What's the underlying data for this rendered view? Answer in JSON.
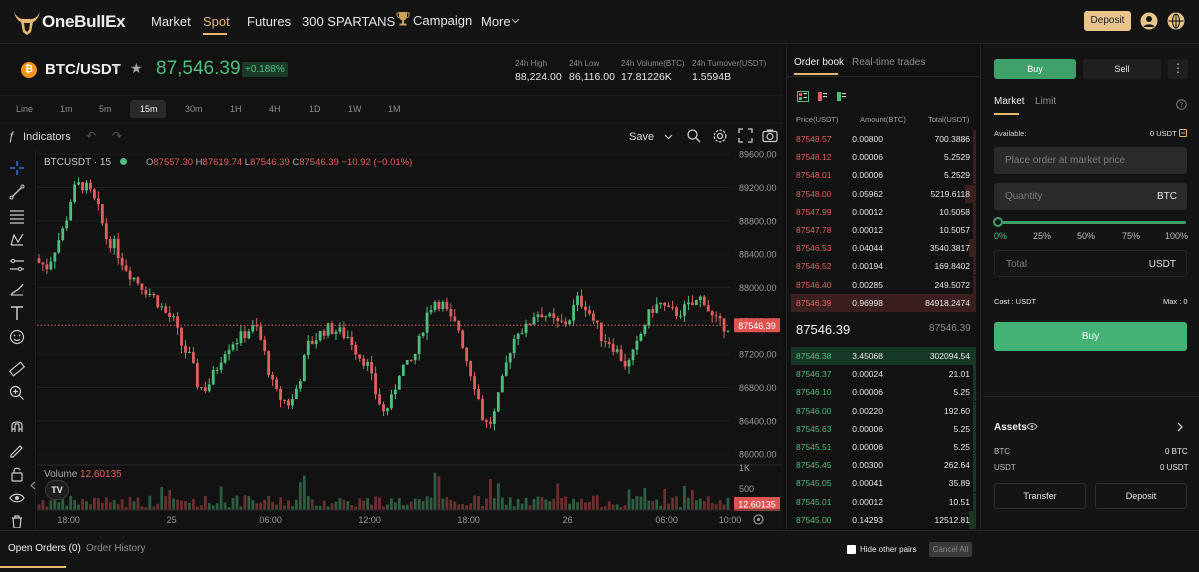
{
  "nav": {
    "logo": "OneBullEx",
    "items": [
      "Market",
      "Spot",
      "Futures",
      "300 SPARTANS",
      "Campaign",
      "More"
    ],
    "deposit": "Deposit"
  },
  "ticker": {
    "pair": "BTC/USDT",
    "price": "87,546.39",
    "change": "+0.188%",
    "stats": [
      {
        "label": "24h High",
        "value": "88,224.00"
      },
      {
        "label": "24h Low",
        "value": "86,116.00"
      },
      {
        "label": "24h Volume(BTC)",
        "value": "17.81226K"
      },
      {
        "label": "24h Turnover(USDT)",
        "value": "1.5594B"
      }
    ]
  },
  "intervals": [
    "Line",
    "1m",
    "5m",
    "15m",
    "30m",
    "1H",
    "4H",
    "1D",
    "1W",
    "1M"
  ],
  "toolbar": {
    "indicators": "Indicators",
    "save": "Save"
  },
  "chart": {
    "symbol": "BTCUSDT · 15",
    "ohlc": {
      "o_label": "O",
      "o": "87557.30",
      "h_label": "H",
      "h": "87619.74",
      "l_label": "L",
      "l": "87546.39",
      "c_label": "C",
      "c": "87546.39",
      "chg": "−10.92 (−0.01%)"
    },
    "volume_label": "Volume",
    "volume_value": "12.60135",
    "tv": "TV"
  },
  "chart_data": {
    "type": "candlestick",
    "y_ticks": [
      89600,
      89200,
      88800,
      88400,
      88000,
      87600,
      87200,
      86800,
      86400,
      86000
    ],
    "y_tick_labels": [
      "89600.00",
      "89200.00",
      "88800.00",
      "88400.00",
      "88000.00",
      "87600.00",
      "87200.00",
      "86800.00",
      "86400.00",
      "86000.00"
    ],
    "ylim": [
      85930,
      89650
    ],
    "x_tick_labels": [
      "18:00",
      "25",
      "06:00",
      "12:00",
      "18:00",
      "26",
      "06:00",
      "10:00"
    ],
    "x_tick_index": [
      8,
      34,
      59,
      84,
      109,
      134,
      159,
      175
    ],
    "current_price": 87546.39,
    "current_price_label": "87546.39",
    "vol_ticks": [
      "1K",
      "500"
    ],
    "volume_label_right": "12.60135",
    "close_path": [
      88300,
      88250,
      88500,
      88720,
      89150,
      89250,
      89150,
      88950,
      88600,
      88500,
      88300,
      88150,
      88050,
      87950,
      87850,
      87700,
      87600,
      87300,
      87150,
      86800,
      86800,
      87000,
      87250,
      87350,
      87400,
      87500,
      87500,
      87150,
      86750,
      86650,
      86600,
      86900,
      87300,
      87400,
      87500,
      87500,
      87450,
      87400,
      87200,
      87100,
      86750,
      86500,
      86650,
      87050,
      87050,
      87250,
      87650,
      87850,
      87800,
      87600,
      87500,
      87100,
      86800,
      86350,
      86400,
      86800,
      87250,
      87500,
      87500,
      87700,
      87700,
      87600,
      87550,
      87600,
      87850,
      87800,
      87600,
      87400,
      87350,
      87200,
      87050,
      87250,
      87550,
      87750,
      87800,
      87700,
      87700,
      87750,
      87800,
      87900,
      87650,
      87550,
      87546
    ]
  },
  "orderbook": {
    "tabs": [
      "Order book",
      "Real-time trades"
    ],
    "headers": [
      "Price(USDT)",
      "Amount(BTC)",
      "Total(USDT)"
    ],
    "asks": [
      [
        "87548.57",
        "0.00800",
        "700.3886",
        0.01
      ],
      [
        "87548.12",
        "0.00006",
        "5.2529",
        0.0
      ],
      [
        "87548.01",
        "0.00006",
        "5.2529",
        0.0
      ],
      [
        "87548.00",
        "0.05962",
        "5219.6118",
        0.06
      ],
      [
        "87547.99",
        "0.00012",
        "10.5058",
        0.0
      ],
      [
        "87547.78",
        "0.00012",
        "10.5057",
        0.0
      ],
      [
        "87546.53",
        "0.04044",
        "3540.3817",
        0.04
      ],
      [
        "87546.52",
        "0.00194",
        "169.8402",
        0.0
      ],
      [
        "87546.40",
        "0.00285",
        "249.5072",
        0.0
      ],
      [
        "87546.39",
        "0.96998",
        "84918.2474",
        1.0
      ]
    ],
    "mid": "87546.39",
    "mid_secondary": "87546.39",
    "bids": [
      [
        "87546.38",
        "3.45068",
        "302094.54",
        1.0
      ],
      [
        "87546.37",
        "0.00024",
        "21.01",
        0.0
      ],
      [
        "87546.10",
        "0.00006",
        "5.25",
        0.0
      ],
      [
        "87546.00",
        "0.00220",
        "192.60",
        0.0
      ],
      [
        "87545.63",
        "0.00006",
        "5.25",
        0.0
      ],
      [
        "87545.51",
        "0.00006",
        "5.25",
        0.0
      ],
      [
        "87545.45",
        "0.00300",
        "262.64",
        0.0
      ],
      [
        "87545.05",
        "0.00041",
        "35.89",
        0.0
      ],
      [
        "87545.01",
        "0.00012",
        "10.51",
        0.0
      ],
      [
        "87545.00",
        "0.14293",
        "12512.81",
        0.04
      ]
    ],
    "hide_other": "Hide other pairs",
    "cancel_all": "Cancel All"
  },
  "trade": {
    "buy_tab": "Buy",
    "sell_tab": "Sell",
    "market": "Market",
    "limit": "Limit",
    "available_label": "Available:",
    "available_value": "0 USDT",
    "market_ph": "Place order at market price",
    "quantity_ph": "Quantity",
    "quantity_unit": "BTC",
    "slider_labels": [
      "0%",
      "25%",
      "50%",
      "75%",
      "100%"
    ],
    "slider_value": 0,
    "total_ph": "Total",
    "total_unit": "USDT",
    "cost": "Cost : USDT",
    "max": "Max : 0",
    "buy_button": "Buy",
    "assets": "Assets",
    "assets_rows": [
      {
        "label": "BTC",
        "value": "0 BTC"
      },
      {
        "label": "USDT",
        "value": "0 USDT"
      }
    ],
    "transfer": "Transfer",
    "deposit": "Deposit"
  },
  "bottom": {
    "tabs": [
      "Open Orders (0)",
      "Order History"
    ]
  },
  "colors": {
    "up": "#4fbf7e",
    "down": "#e06060",
    "accent": "#e6b870"
  }
}
